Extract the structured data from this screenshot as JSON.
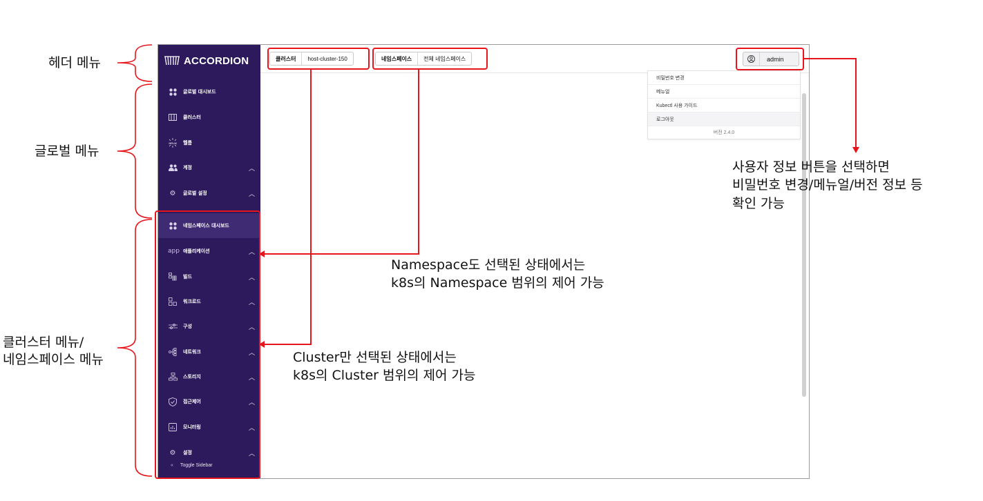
{
  "app": {
    "logo_text": "ACCORDION",
    "sidebar": {
      "global_items": [
        {
          "label": "글로벌 대시보드",
          "icon": "dashboard-icon"
        },
        {
          "label": "클러스터",
          "icon": "cluster-icon"
        },
        {
          "label": "헬름",
          "icon": "helm-icon"
        },
        {
          "label": "계정",
          "icon": "users-icon"
        },
        {
          "label": "글로벌 설정",
          "icon": "gear-icon"
        }
      ],
      "namespace_items": [
        {
          "label": "네임스페이스 대시보드",
          "icon": "dashboard-icon"
        },
        {
          "label": "애플리케이션",
          "icon": "app-icon",
          "icon_text": "app"
        },
        {
          "label": "빌드",
          "icon": "build-icon"
        },
        {
          "label": "워크로드",
          "icon": "workload-icon"
        },
        {
          "label": "구성",
          "icon": "config-icon"
        },
        {
          "label": "네트워크",
          "icon": "network-icon"
        },
        {
          "label": "스토리지",
          "icon": "storage-icon"
        },
        {
          "label": "접근제어",
          "icon": "shield-icon"
        },
        {
          "label": "모니터링",
          "icon": "monitoring-icon"
        },
        {
          "label": "설정",
          "icon": "gear-icon"
        }
      ],
      "toggle": "Toggle Sidebar"
    },
    "header": {
      "cluster_label": "클러스터",
      "cluster_value": "host-cluster-150",
      "namespace_label": "네임스페이스",
      "namespace_value": "전체 네임스페이스",
      "user": "admin"
    },
    "dropdown": {
      "items": [
        "비밀번호 변경",
        "메뉴얼",
        "Kubectl 사용 가이드",
        "로그아웃"
      ],
      "version": "버전 2.4.0"
    }
  },
  "annotations": {
    "header_menu": "헤더 메뉴",
    "global_menu": "글로벌 메뉴",
    "cluster_ns_menu_line1": "클러스터 메뉴/",
    "cluster_ns_menu_line2": "네임스페이스 메뉴",
    "user_info_line1": "사용자 정보 버튼을 선택하면",
    "user_info_line2": "비밀번호 변경/메뉴얼/버전 정보 등",
    "user_info_line3": "확인 가능",
    "namespace_note_line1": "Namespace도 선택된 상태에서는",
    "namespace_note_line2": "k8s의 Namespace 범위의 제어 가능",
    "cluster_note_line1": "Cluster만 선택된 상태에서는",
    "cluster_note_line2": "k8s의 Cluster 범위의 제어 가능"
  },
  "colors": {
    "sidebar_bg": "#2d1a5c",
    "annotation_red": "#e8141c"
  }
}
